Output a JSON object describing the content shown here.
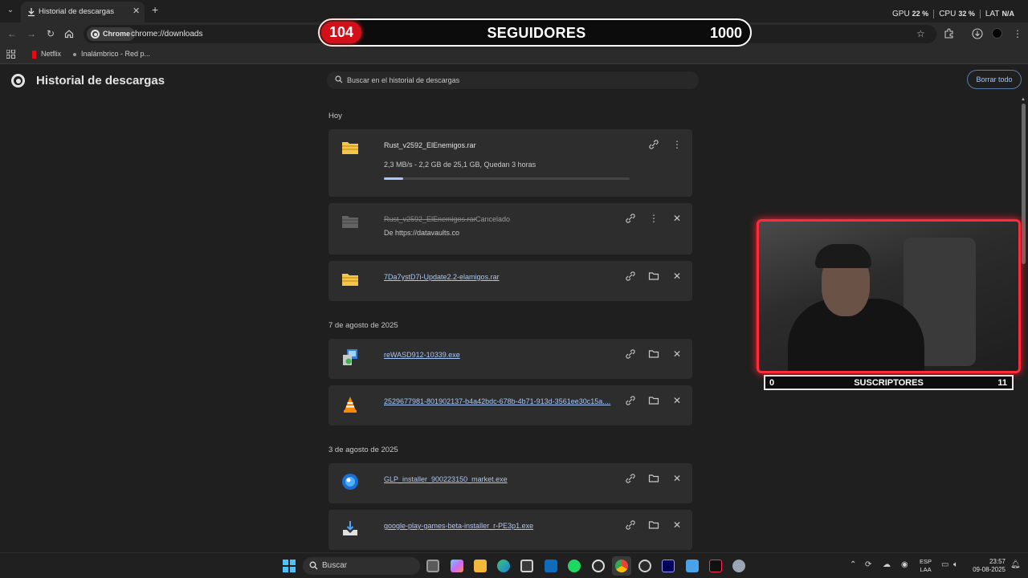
{
  "tab": {
    "title": "Historial de descargas"
  },
  "stats": {
    "gpu_label": "GPU",
    "gpu_value": "22 %",
    "cpu_label": "CPU",
    "cpu_value": "32 %",
    "lat_label": "LAT",
    "lat_value": "N/A"
  },
  "omnibox": {
    "chip": "Chrome",
    "url": "chrome://downloads"
  },
  "bookmarks": [
    {
      "label": "Netflix"
    },
    {
      "label": "Inalámbrico - Red p..."
    }
  ],
  "overlay": {
    "followers_count": "104",
    "followers_title": "SEGUIDORES",
    "followers_goal": "1000",
    "subs_current": "0",
    "subs_title": "SUSCRIPTORES",
    "subs_goal": "11"
  },
  "page": {
    "title": "Historial de descargas",
    "search_placeholder": "Buscar en el historial de descargas",
    "clear_all": "Borrar todo"
  },
  "groups": [
    {
      "date": "Hoy",
      "items": [
        {
          "name": "Rust_v2592_ElEnemigos.rar",
          "detail": "2,3 MB/s - 2,2 GB de 25,1 GB, Quedan 3 horas",
          "progress_percent": 8,
          "state": "downloading"
        },
        {
          "name": "Rust_v2592_ElEnemigos.rar",
          "status": "Cancelado",
          "detail": "De https://datavaults.co",
          "state": "cancelled"
        },
        {
          "name": "7Da7ystD7i-Update2.2-elamigos.rar",
          "state": "done"
        }
      ]
    },
    {
      "date": "7 de agosto de 2025",
      "items": [
        {
          "name": "reWASD912-10339.exe",
          "state": "done"
        },
        {
          "name": "2529677981-801902137-b4a42bdc-678b-4b71-913d-3561ee30c15a....",
          "state": "done"
        }
      ]
    },
    {
      "date": "3 de agosto de 2025",
      "items": [
        {
          "name": "GLP_installer_900223150_market.exe",
          "state": "done"
        },
        {
          "name": "google-play-games-beta-installer_r-PE3p1.exe",
          "state": "done"
        }
      ]
    }
  ],
  "taskbar": {
    "search_label": "Buscar",
    "lang_line1": "ESP",
    "lang_line2": "LAA",
    "time": "23:57",
    "date": "09-08-2025"
  },
  "colors": {
    "accent": "#a8c7fa",
    "overlay_red": "#d3101a",
    "webcam_border": "#ff2b3a"
  }
}
